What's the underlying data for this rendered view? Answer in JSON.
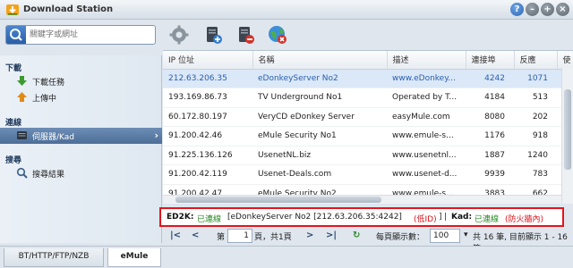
{
  "window": {
    "title": "Download Station",
    "help_label": "?",
    "min_label": "–",
    "max_label": "+",
    "close_label": "×"
  },
  "search": {
    "placeholder": "關鍵字或網址"
  },
  "sidebar": {
    "sections": [
      {
        "title": "下載",
        "items": [
          {
            "label": "下載任務",
            "icon": "download-arrow-icon"
          },
          {
            "label": "上傳中",
            "icon": "upload-arrow-icon"
          }
        ]
      },
      {
        "title": "連線",
        "items": [
          {
            "label": "伺服器/Kad",
            "icon": "server-icon",
            "active": true
          }
        ]
      },
      {
        "title": "搜尋",
        "items": [
          {
            "label": "搜尋結果",
            "icon": "magnifier-icon"
          }
        ]
      }
    ],
    "chevron": "›"
  },
  "table": {
    "columns": [
      "IP 位址",
      "名稱",
      "描述",
      "連接埠",
      "反應",
      "使"
    ],
    "rows": [
      {
        "ip": "212.63.206.35",
        "name": "eDonkeyServer No2",
        "desc": "www.eDonkey...",
        "port": "4242",
        "resp": "1071",
        "selected": true
      },
      {
        "ip": "193.169.86.73",
        "name": "TV Underground No1",
        "desc": "Operated by T...",
        "port": "4184",
        "resp": "513"
      },
      {
        "ip": "60.172.80.197",
        "name": "VeryCD eDonkey Server",
        "desc": "easyMule.com",
        "port": "8080",
        "resp": "202"
      },
      {
        "ip": "91.200.42.46",
        "name": "eMule Security No1",
        "desc": "www.emule-s...",
        "port": "1176",
        "resp": "918"
      },
      {
        "ip": "91.225.136.126",
        "name": "UsenetNL.biz",
        "desc": "www.usenetnl...",
        "port": "1887",
        "resp": "1240"
      },
      {
        "ip": "91.200.42.119",
        "name": "Usenet-Deals.com",
        "desc": "www.usenet-d...",
        "port": "9939",
        "resp": "783"
      },
      {
        "ip": "91.200.42.47",
        "name": "eMule Security No2",
        "desc": "www.emule-s...",
        "port": "3883",
        "resp": "662"
      }
    ]
  },
  "status": {
    "ed2k_label": "ED2K:",
    "ed2k_state": "已連線",
    "ed2k_server": "[eDonkeyServer No2 [212.63.206.35:4242]",
    "ed2k_id": "(低ID)",
    "ed2k_close": "]",
    "divider": "|",
    "kad_label": "Kad:",
    "kad_state": "已連線",
    "kad_fw": "(防火牆內)"
  },
  "pager": {
    "first": "|<",
    "prev": "<",
    "page_prefix": "第",
    "page_value": "1",
    "page_suffix": "頁，共1頁",
    "next": ">",
    "last": ">|",
    "refresh": "↻",
    "per_page_label": "每頁顯示數：",
    "per_page_value": "100",
    "summary": "共 16 筆, 目前顯示 1 - 16 筆"
  },
  "tabs": [
    {
      "label": "BT/HTTP/FTP/NZB"
    },
    {
      "label": "eMule",
      "active": true
    }
  ],
  "colors": {
    "accent": "#2a5fb0",
    "highlight_border": "#e3141c",
    "connected": "#2c8a2a",
    "warning": "#d8121b"
  }
}
